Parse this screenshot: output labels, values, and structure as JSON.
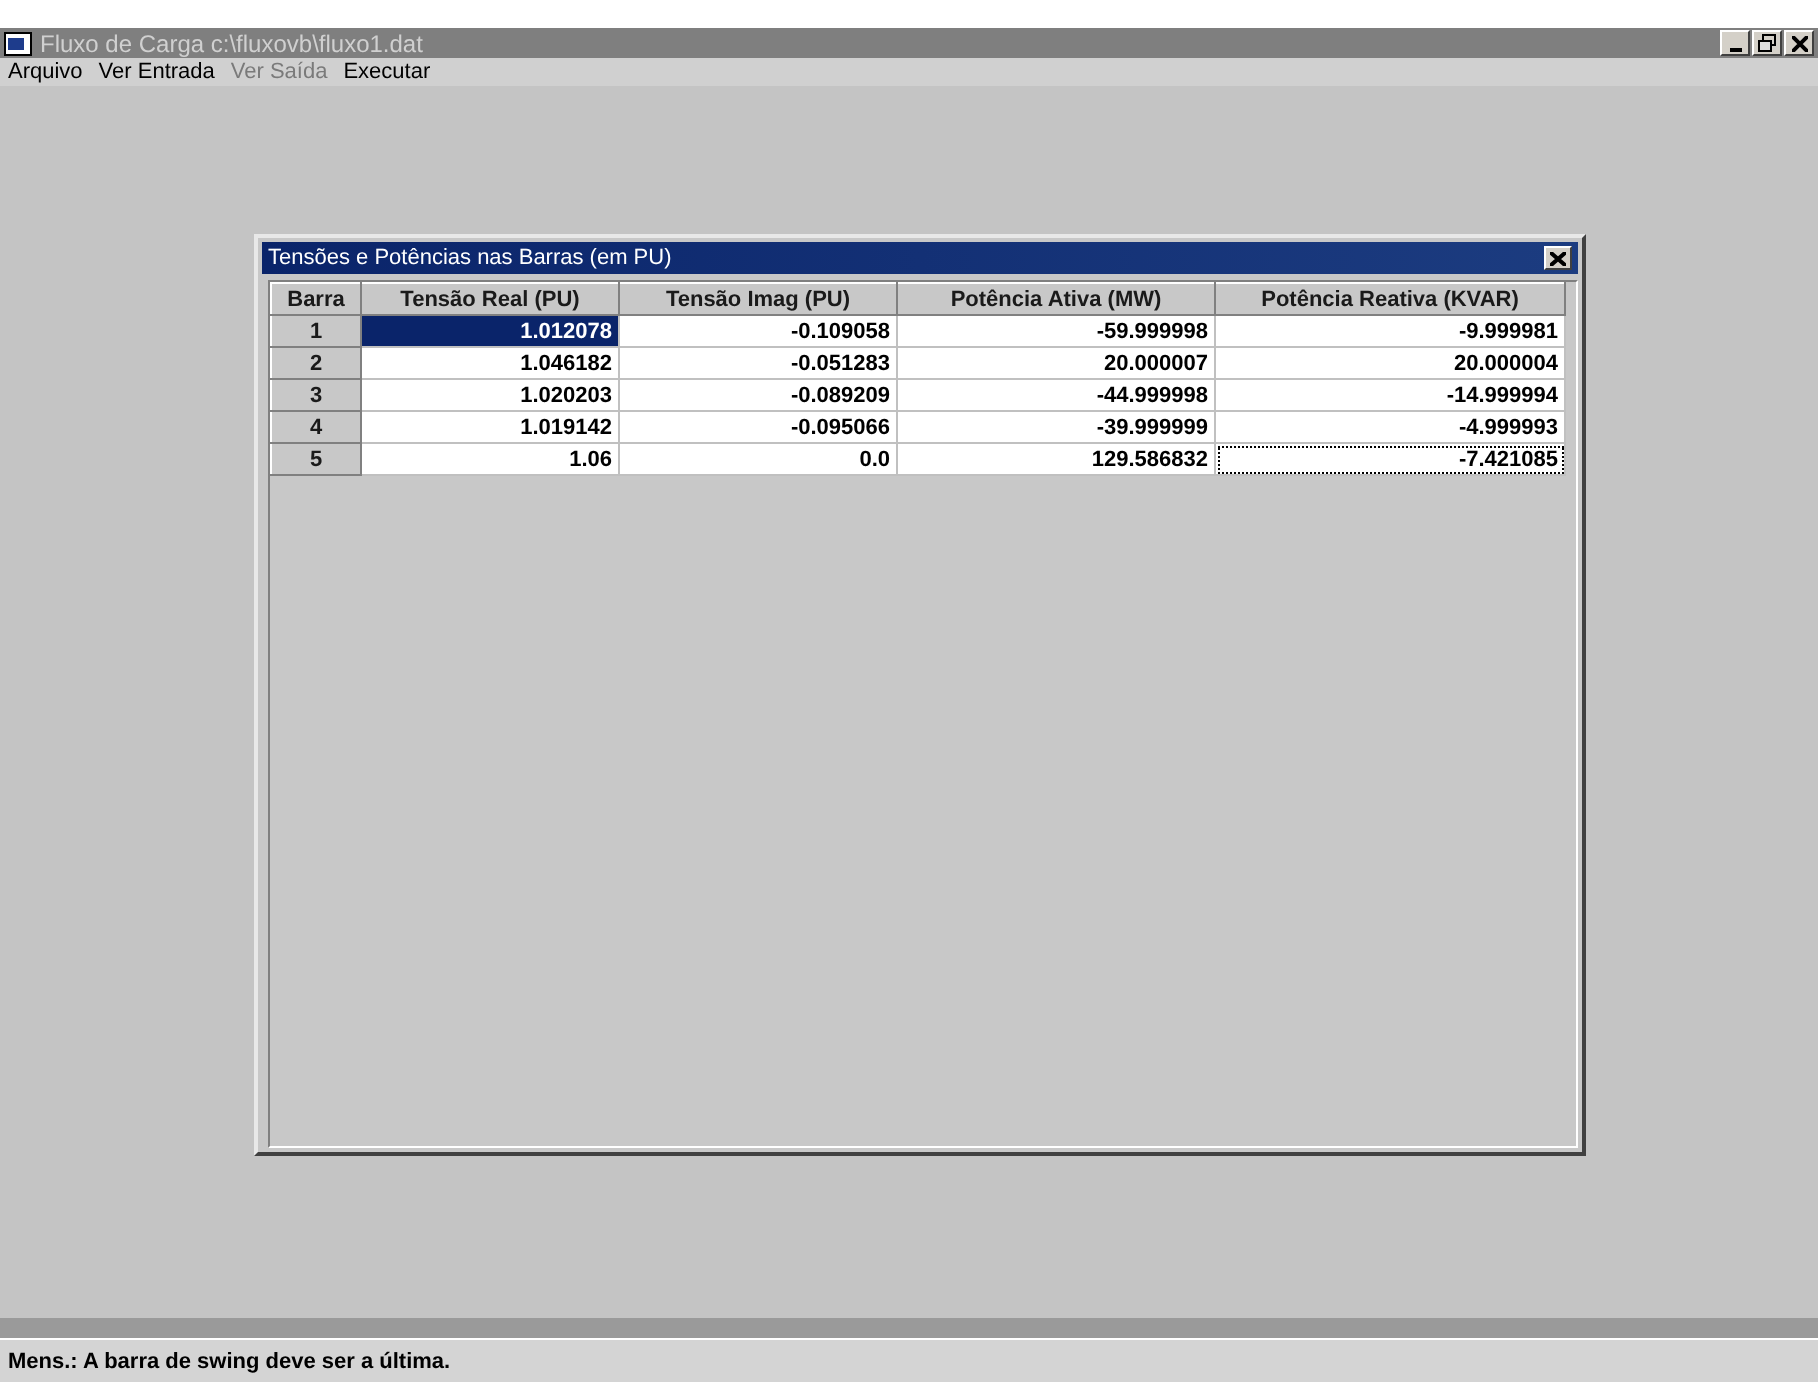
{
  "window": {
    "title": "Fluxo de Carga c:\\fluxovb\\fluxo1.dat",
    "active": false
  },
  "menu": [
    {
      "label": "Arquivo",
      "disabled": false
    },
    {
      "label": "Ver Entrada",
      "disabled": false
    },
    {
      "label": "Ver Saída",
      "disabled": true
    },
    {
      "label": "Executar",
      "disabled": false
    }
  ],
  "dialog": {
    "title": "Tensões e Potências nas Barras (em PU)",
    "table": {
      "columns": [
        "Barra",
        "Tensão Real (PU)",
        "Tensão Imag (PU)",
        "Potência Ativa (MW)",
        "Potência Reativa (KVAR)"
      ],
      "rows": [
        {
          "cells": [
            {
              "text": "1",
              "selected": false,
              "focused": false
            },
            {
              "text": "1.012078",
              "selected": true,
              "focused": false
            },
            {
              "text": "-0.109058",
              "selected": false,
              "focused": false
            },
            {
              "text": "-59.999998",
              "selected": false,
              "focused": false
            },
            {
              "text": "-9.999981",
              "selected": false,
              "focused": false
            }
          ]
        },
        {
          "cells": [
            {
              "text": "2",
              "selected": false,
              "focused": false
            },
            {
              "text": "1.046182",
              "selected": false,
              "focused": false
            },
            {
              "text": "-0.051283",
              "selected": false,
              "focused": false
            },
            {
              "text": "20.000007",
              "selected": false,
              "focused": false
            },
            {
              "text": "20.000004",
              "selected": false,
              "focused": false
            }
          ]
        },
        {
          "cells": [
            {
              "text": "3",
              "selected": false,
              "focused": false
            },
            {
              "text": "1.020203",
              "selected": false,
              "focused": false
            },
            {
              "text": "-0.089209",
              "selected": false,
              "focused": false
            },
            {
              "text": "-44.999998",
              "selected": false,
              "focused": false
            },
            {
              "text": "-14.999994",
              "selected": false,
              "focused": false
            }
          ]
        },
        {
          "cells": [
            {
              "text": "4",
              "selected": false,
              "focused": false
            },
            {
              "text": "1.019142",
              "selected": false,
              "focused": false
            },
            {
              "text": "-0.095066",
              "selected": false,
              "focused": false
            },
            {
              "text": "-39.999999",
              "selected": false,
              "focused": false
            },
            {
              "text": "-4.999993",
              "selected": false,
              "focused": false
            }
          ]
        },
        {
          "cells": [
            {
              "text": "5",
              "selected": false,
              "focused": false
            },
            {
              "text": "1.06",
              "selected": false,
              "focused": false
            },
            {
              "text": "0.0",
              "selected": false,
              "focused": false
            },
            {
              "text": "129.586832",
              "selected": false,
              "focused": false
            },
            {
              "text": "-7.421085",
              "selected": false,
              "focused": true
            }
          ]
        }
      ]
    }
  },
  "status_bar": {
    "message": "Mens.: A barra de swing deve ser a última."
  }
}
